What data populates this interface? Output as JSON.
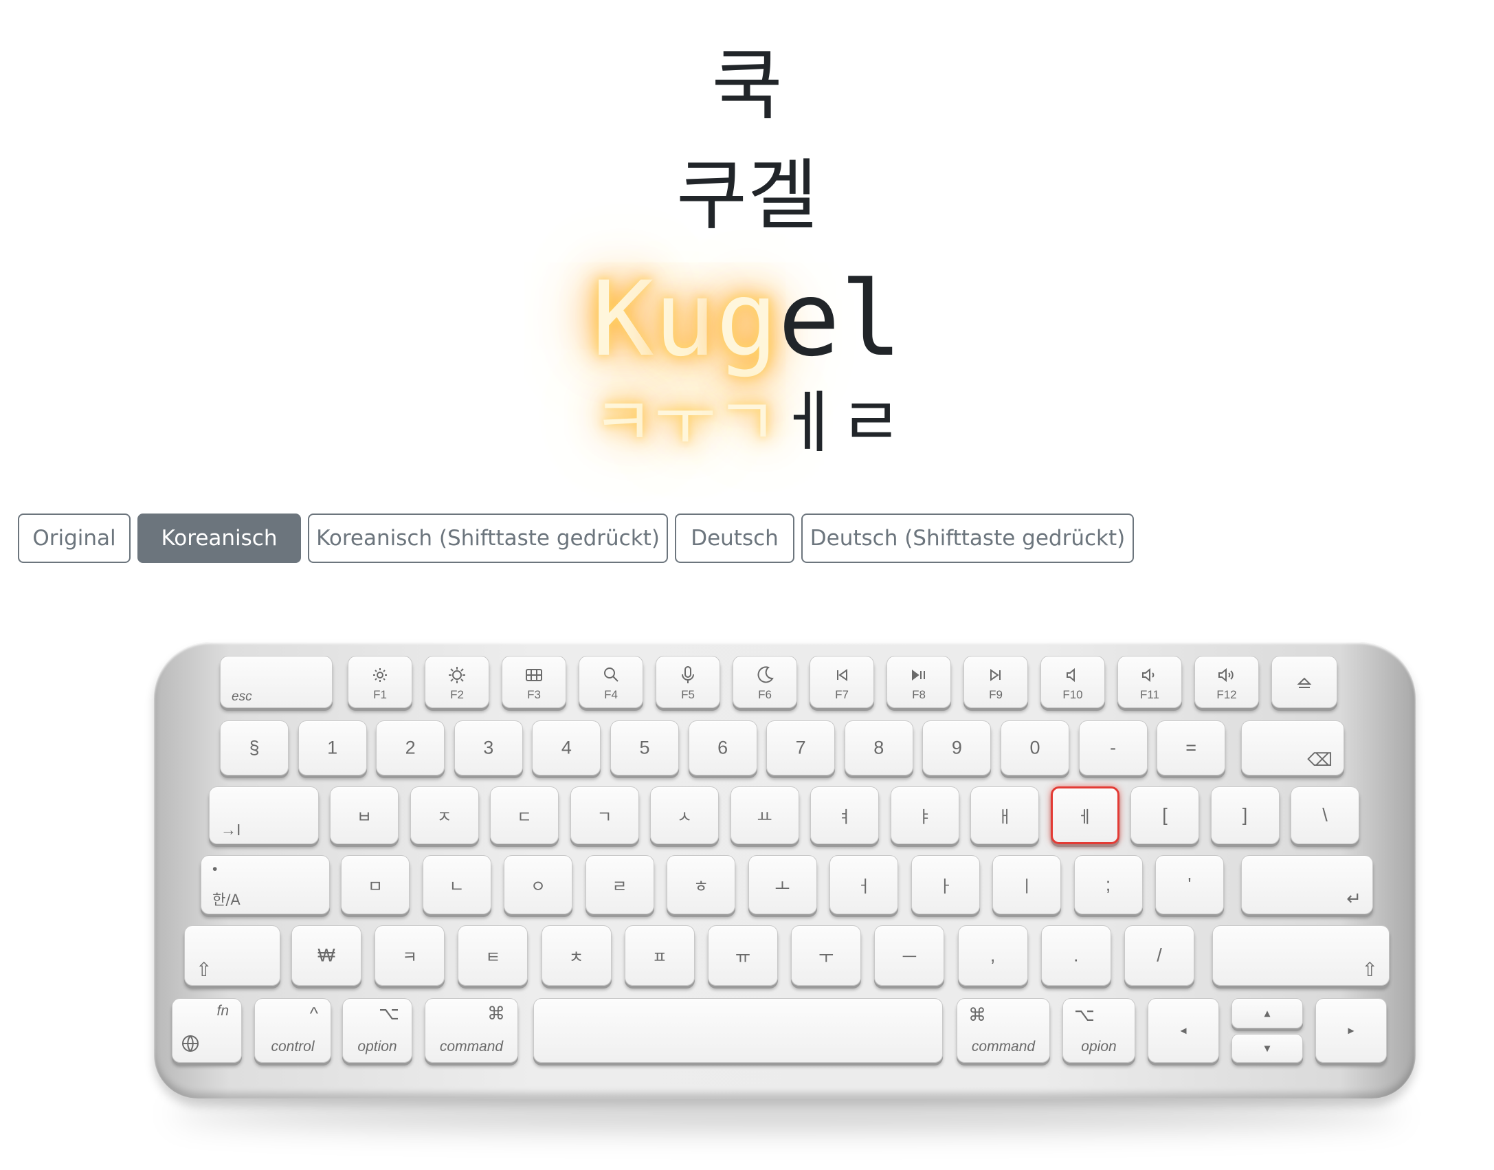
{
  "display": {
    "line1": "쿡",
    "line2": "쿠겔",
    "latin": {
      "typed": [
        "K",
        "u",
        "g"
      ],
      "rest": [
        "e",
        "l"
      ]
    },
    "jamo": {
      "typed": [
        "ㅋ",
        "ㅜ",
        "ㄱ"
      ],
      "rest": [
        "ㅔ",
        "ㄹ"
      ]
    }
  },
  "buttons": [
    {
      "label": "Original",
      "active": false
    },
    {
      "label": "Koreanisch",
      "active": true
    },
    {
      "label": "Koreanisch (Shifttaste gedrückt)",
      "active": false
    },
    {
      "label": "Deutsch",
      "active": false
    },
    {
      "label": "Deutsch (Shifttaste gedrückt)",
      "active": false
    }
  ],
  "keyboard": {
    "highlighted_key": "ㅔ",
    "function_row": {
      "esc": "esc",
      "fkeys": [
        {
          "label": "F1",
          "icon": "brightness-down-icon"
        },
        {
          "label": "F2",
          "icon": "brightness-up-icon"
        },
        {
          "label": "F3",
          "icon": "mission-control-icon"
        },
        {
          "label": "F4",
          "icon": "search-icon"
        },
        {
          "label": "F5",
          "icon": "microphone-icon"
        },
        {
          "label": "F6",
          "icon": "moon-icon"
        },
        {
          "label": "F7",
          "icon": "rewind-icon"
        },
        {
          "label": "F8",
          "icon": "play-pause-icon"
        },
        {
          "label": "F9",
          "icon": "fast-forward-icon"
        },
        {
          "label": "F10",
          "icon": "mute-icon"
        },
        {
          "label": "F11",
          "icon": "volume-down-icon"
        },
        {
          "label": "F12",
          "icon": "volume-up-icon"
        }
      ],
      "eject": "eject-icon"
    },
    "number_row": [
      "§",
      "1",
      "2",
      "3",
      "4",
      "5",
      "6",
      "7",
      "8",
      "9",
      "0",
      "-",
      "="
    ],
    "q_row": [
      "ㅂ",
      "ㅈ",
      "ㄷ",
      "ㄱ",
      "ㅅ",
      "ㅛ",
      "ㅕ",
      "ㅑ",
      "ㅐ",
      "ㅔ",
      "[",
      "]",
      "\\"
    ],
    "a_row": [
      "ㅁ",
      "ㄴ",
      "ㅇ",
      "ㄹ",
      "ㅎ",
      "ㅗ",
      "ㅓ",
      "ㅏ",
      "ㅣ",
      ";",
      "'"
    ],
    "z_row": [
      "₩",
      "ㅋ",
      "ㅌ",
      "ㅊ",
      "ㅍ",
      "ㅠ",
      "ㅜ",
      "ㅡ",
      ",",
      ".",
      "/"
    ],
    "tab_glyph": "→I",
    "caps_label": "한/A",
    "caps_dot": "•",
    "delete_glyph": "⌫",
    "return_glyph": "↵",
    "shift_glyph": "⇧",
    "bottom": {
      "fn": "fn",
      "control": "control",
      "control_symbol": "^",
      "option_left": "option",
      "option_right": "opion",
      "option_symbol": "⌥",
      "command": "command",
      "command_symbol": "⌘",
      "arrow_left": "◂",
      "arrow_right": "▸",
      "arrow_up": "▴",
      "arrow_down": "▾"
    }
  }
}
